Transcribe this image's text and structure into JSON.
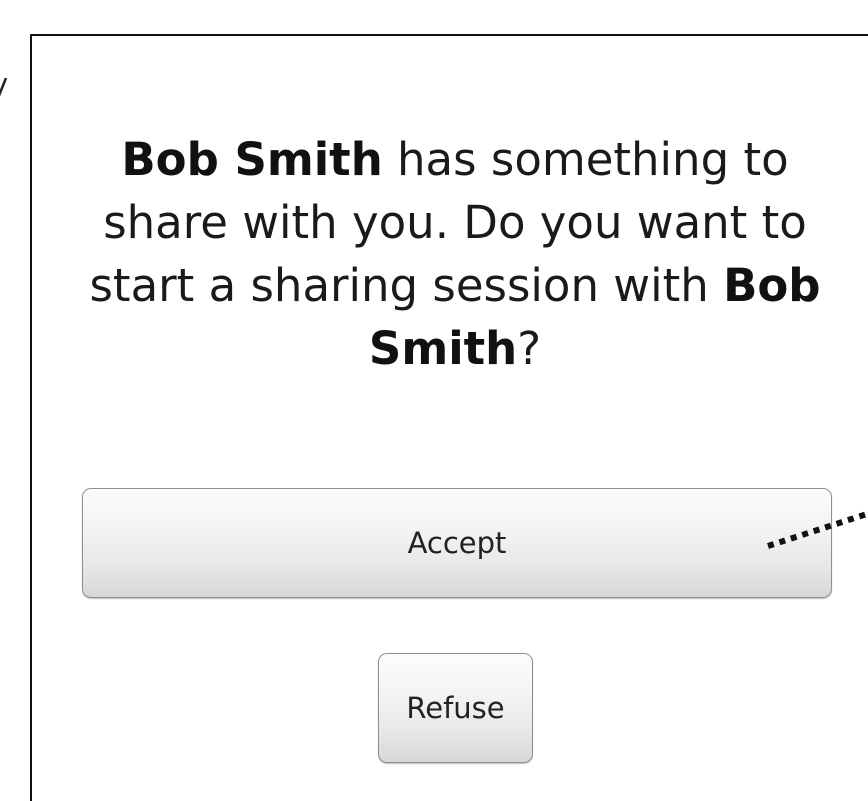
{
  "dialog": {
    "message_parts": {
      "sender_name": "Bob Smith",
      "text_after_sender": " has something to share with you. Do you want to start a sharing session with ",
      "sender_name_repeat": "Bob Smith",
      "trailing_punct": "?"
    },
    "accept_label": "Accept",
    "refuse_label": "Refuse"
  }
}
